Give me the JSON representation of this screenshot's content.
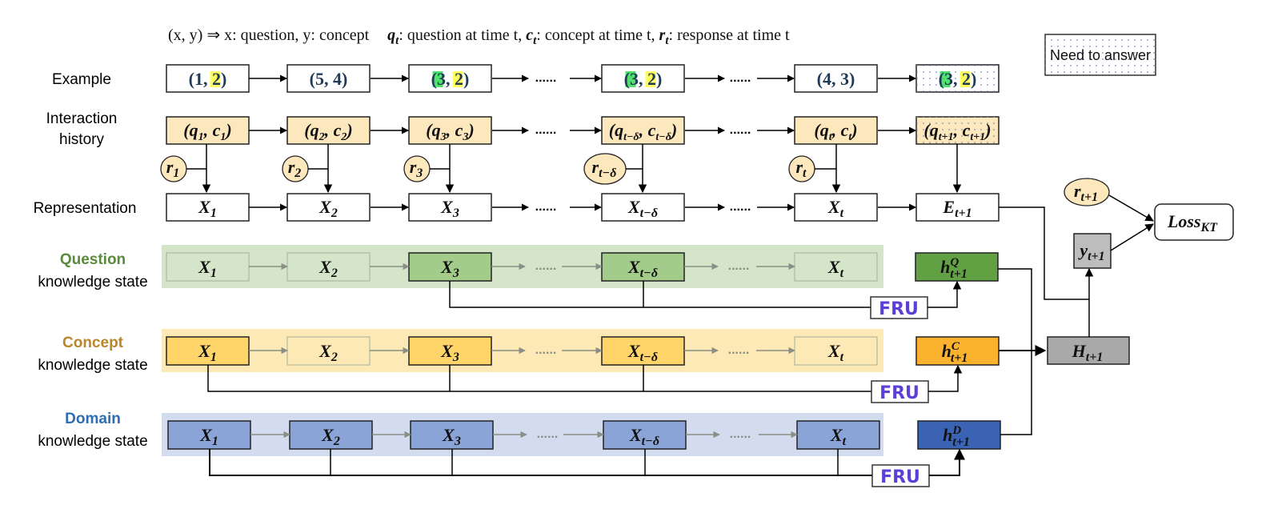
{
  "legend": {
    "part1": "(x, y) ⇒ x: question, y: concept",
    "part2": "q",
    "part2_sub": "t",
    "part2_rest": ": question at time t, ",
    "part3": "c",
    "part3_sub": "t",
    "part3_rest": ": concept at time t, ",
    "part4": "r",
    "part4_sub": "t",
    "part4_rest": ": response at time t"
  },
  "need_to_answer": "Need to answer",
  "row_labels": {
    "example": "Example",
    "interaction_1": "Interaction",
    "interaction_2": "history",
    "representation": "Representation",
    "question_title": "Question",
    "concept_title": "Concept",
    "domain_title": "Domain",
    "knowledge_state": "knowledge state"
  },
  "colors": {
    "question_title": "#5a8a3c",
    "concept_title": "#b8862b",
    "domain_title": "#2e6db4",
    "question_band": "#d4e5c9",
    "concept_band": "#fde9b6",
    "domain_band": "#d2dcee",
    "question_active": "#a3cc8a",
    "concept_active": "#ffd56a",
    "domain_active": "#8aa4d8",
    "hq": "#62a044",
    "hc": "#fbb32f",
    "hd": "#3b63b3",
    "interaction_fill": "#fde7bd",
    "grey_box": "#a9a9a9",
    "grey_y": "#bdbdbd",
    "fru_text": "#5b3fd6",
    "q_highlight": "#33dd55",
    "c_highlight": "#ffff44"
  },
  "ellipsis": "......",
  "example": [
    {
      "q": "1",
      "c": "2",
      "q_hl": false,
      "c_hl": true
    },
    {
      "q": "5",
      "c": "4",
      "q_hl": false,
      "c_hl": false
    },
    {
      "q": "3",
      "c": "2",
      "q_hl": true,
      "c_hl": true
    },
    {
      "q": "3",
      "c": "2",
      "q_hl": true,
      "c_hl": true
    },
    {
      "q": "4",
      "c": "3",
      "q_hl": false,
      "c_hl": false
    },
    {
      "q": "3",
      "c": "2",
      "q_hl": true,
      "c_hl": true
    }
  ],
  "interaction": [
    {
      "q": "q",
      "qs": "1",
      "c": "c",
      "cs": "1"
    },
    {
      "q": "q",
      "qs": "2",
      "c": "c",
      "cs": "2"
    },
    {
      "q": "q",
      "qs": "3",
      "c": "c",
      "cs": "3"
    },
    {
      "q": "q",
      "qs": "t−δ",
      "c": "c",
      "cs": "t−δ"
    },
    {
      "q": "q",
      "qs": "t",
      "c": "c",
      "cs": "t"
    },
    {
      "q": "q",
      "qs": "t+1",
      "c": "c",
      "cs": "t+1"
    }
  ],
  "responses": [
    {
      "r": "r",
      "s": "1"
    },
    {
      "r": "r",
      "s": "2"
    },
    {
      "r": "r",
      "s": "3"
    },
    {
      "r": "r",
      "s": "t−δ"
    },
    {
      "r": "r",
      "s": "t"
    }
  ],
  "representation": [
    {
      "v": "X",
      "s": "1"
    },
    {
      "v": "X",
      "s": "2"
    },
    {
      "v": "X",
      "s": "3"
    },
    {
      "v": "X",
      "s": "t−δ"
    },
    {
      "v": "X",
      "s": "t"
    },
    {
      "v": "E",
      "s": "t+1"
    }
  ],
  "states": {
    "question": [
      {
        "v": "X",
        "s": "1",
        "active": false
      },
      {
        "v": "X",
        "s": "2",
        "active": false
      },
      {
        "v": "X",
        "s": "3",
        "active": true
      },
      {
        "v": "X",
        "s": "t−δ",
        "active": true
      },
      {
        "v": "X",
        "s": "t",
        "active": false
      }
    ],
    "concept": [
      {
        "v": "X",
        "s": "1",
        "active": true
      },
      {
        "v": "X",
        "s": "2",
        "active": false
      },
      {
        "v": "X",
        "s": "3",
        "active": true
      },
      {
        "v": "X",
        "s": "t−δ",
        "active": true
      },
      {
        "v": "X",
        "s": "t",
        "active": false
      }
    ],
    "domain": [
      {
        "v": "X",
        "s": "1",
        "active": true
      },
      {
        "v": "X",
        "s": "2",
        "active": true
      },
      {
        "v": "X",
        "s": "3",
        "active": true
      },
      {
        "v": "X",
        "s": "t−δ",
        "active": true
      },
      {
        "v": "X",
        "s": "t",
        "active": true
      }
    ]
  },
  "fru_label": "FRU",
  "hidden": {
    "hq": {
      "v": "h",
      "sup": "Q",
      "sub": "t+1"
    },
    "hc": {
      "v": "h",
      "sup": "C",
      "sub": "t+1"
    },
    "hd": {
      "v": "h",
      "sup": "D",
      "sub": "t+1"
    }
  },
  "H": {
    "v": "H",
    "s": "t+1"
  },
  "y": {
    "v": "y",
    "s": "t+1"
  },
  "r_next": {
    "v": "r",
    "s": "t+1"
  },
  "loss": {
    "v": "Loss",
    "s": "KT"
  }
}
